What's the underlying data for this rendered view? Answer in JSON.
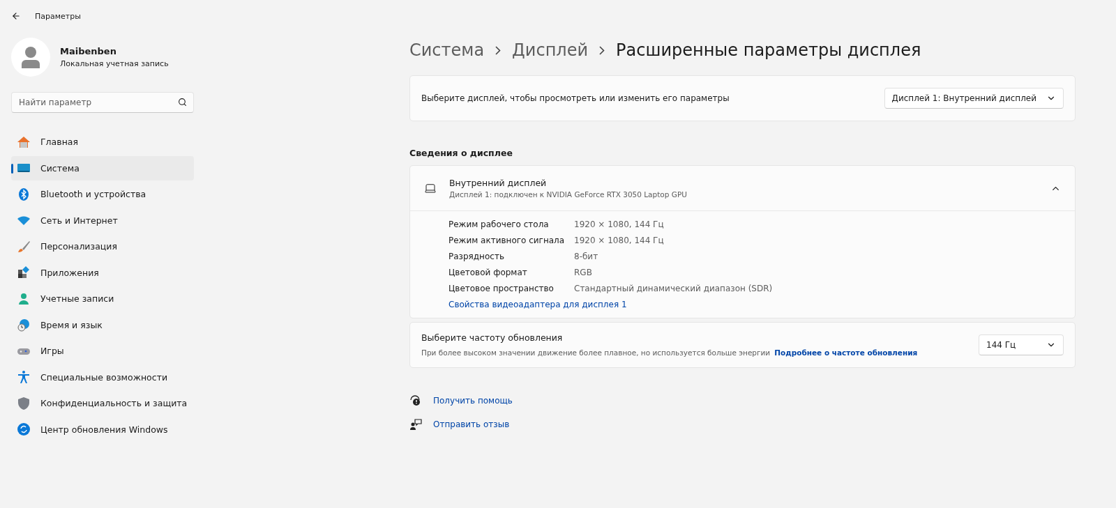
{
  "window": {
    "title": "Параметры"
  },
  "account": {
    "name": "Maibenben",
    "type": "Локальная учетная запись"
  },
  "search": {
    "placeholder": "Найти параметр"
  },
  "sidebar": {
    "items": [
      {
        "label": "Главная",
        "kind": "home",
        "selected": false
      },
      {
        "label": "Система",
        "kind": "system",
        "selected": true
      },
      {
        "label": "Bluetooth и устройства",
        "kind": "bluetooth",
        "selected": false
      },
      {
        "label": "Сеть и Интернет",
        "kind": "network",
        "selected": false
      },
      {
        "label": "Персонализация",
        "kind": "brush",
        "selected": false
      },
      {
        "label": "Приложения",
        "kind": "apps",
        "selected": false
      },
      {
        "label": "Учетные записи",
        "kind": "person",
        "selected": false
      },
      {
        "label": "Время и язык",
        "kind": "time",
        "selected": false
      },
      {
        "label": "Игры",
        "kind": "games",
        "selected": false
      },
      {
        "label": "Специальные возможности",
        "kind": "accessibility",
        "selected": false
      },
      {
        "label": "Конфиденциальность и защита",
        "kind": "shield",
        "selected": false
      },
      {
        "label": "Центр обновления Windows",
        "kind": "update",
        "selected": false
      }
    ]
  },
  "breadcrumb": [
    "Система",
    "Дисплей",
    "Расширенные параметры дисплея"
  ],
  "display_select": {
    "label": "Выберите дисплей, чтобы просмотреть или изменить его параметры",
    "value": "Дисплей 1: Внутренний дисплей"
  },
  "section_title": "Сведения о дисплее",
  "display_info": {
    "title": "Внутренний дисплей",
    "subtitle": "Дисплей 1: подключен к NVIDIA GeForce RTX 3050 Laptop GPU",
    "expanded": true,
    "rows": [
      {
        "label": "Режим рабочего стола",
        "value": "1920 × 1080, 144 Гц"
      },
      {
        "label": "Режим активного сигнала",
        "value": "1920 × 1080, 144 Гц"
      },
      {
        "label": "Разрядность",
        "value": "8-бит"
      },
      {
        "label": "Цветовой формат",
        "value": "RGB"
      },
      {
        "label": "Цветовое пространство",
        "value": "Стандартный динамический диапазон (SDR)"
      }
    ],
    "link": "Свойства видеоадаптера для дисплея 1"
  },
  "refresh_rate": {
    "title": "Выберите частоту обновления",
    "description": "При более высоком значении движение более плавное, но используется больше энергии",
    "link": "Подробнее о частоте обновления",
    "value": "144 Гц"
  },
  "help_links": [
    {
      "label": "Получить помощь",
      "kind": "help"
    },
    {
      "label": "Отправить отзыв",
      "kind": "feedback"
    }
  ]
}
